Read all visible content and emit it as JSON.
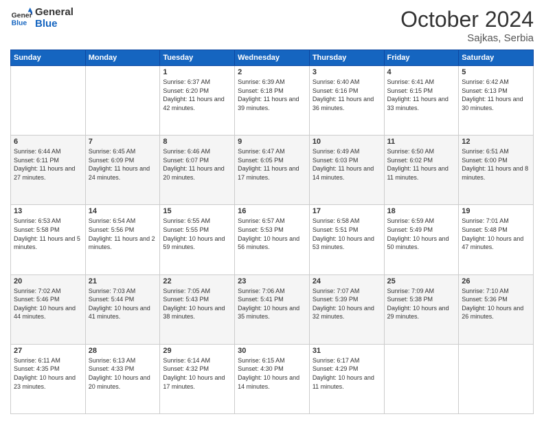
{
  "header": {
    "logo_line1": "General",
    "logo_line2": "Blue",
    "month": "October 2024",
    "location": "Sajkas, Serbia"
  },
  "days_of_week": [
    "Sunday",
    "Monday",
    "Tuesday",
    "Wednesday",
    "Thursday",
    "Friday",
    "Saturday"
  ],
  "weeks": [
    [
      {
        "day": "",
        "content": ""
      },
      {
        "day": "",
        "content": ""
      },
      {
        "day": "1",
        "content": "Sunrise: 6:37 AM\nSunset: 6:20 PM\nDaylight: 11 hours and 42 minutes."
      },
      {
        "day": "2",
        "content": "Sunrise: 6:39 AM\nSunset: 6:18 PM\nDaylight: 11 hours and 39 minutes."
      },
      {
        "day": "3",
        "content": "Sunrise: 6:40 AM\nSunset: 6:16 PM\nDaylight: 11 hours and 36 minutes."
      },
      {
        "day": "4",
        "content": "Sunrise: 6:41 AM\nSunset: 6:15 PM\nDaylight: 11 hours and 33 minutes."
      },
      {
        "day": "5",
        "content": "Sunrise: 6:42 AM\nSunset: 6:13 PM\nDaylight: 11 hours and 30 minutes."
      }
    ],
    [
      {
        "day": "6",
        "content": "Sunrise: 6:44 AM\nSunset: 6:11 PM\nDaylight: 11 hours and 27 minutes."
      },
      {
        "day": "7",
        "content": "Sunrise: 6:45 AM\nSunset: 6:09 PM\nDaylight: 11 hours and 24 minutes."
      },
      {
        "day": "8",
        "content": "Sunrise: 6:46 AM\nSunset: 6:07 PM\nDaylight: 11 hours and 20 minutes."
      },
      {
        "day": "9",
        "content": "Sunrise: 6:47 AM\nSunset: 6:05 PM\nDaylight: 11 hours and 17 minutes."
      },
      {
        "day": "10",
        "content": "Sunrise: 6:49 AM\nSunset: 6:03 PM\nDaylight: 11 hours and 14 minutes."
      },
      {
        "day": "11",
        "content": "Sunrise: 6:50 AM\nSunset: 6:02 PM\nDaylight: 11 hours and 11 minutes."
      },
      {
        "day": "12",
        "content": "Sunrise: 6:51 AM\nSunset: 6:00 PM\nDaylight: 11 hours and 8 minutes."
      }
    ],
    [
      {
        "day": "13",
        "content": "Sunrise: 6:53 AM\nSunset: 5:58 PM\nDaylight: 11 hours and 5 minutes."
      },
      {
        "day": "14",
        "content": "Sunrise: 6:54 AM\nSunset: 5:56 PM\nDaylight: 11 hours and 2 minutes."
      },
      {
        "day": "15",
        "content": "Sunrise: 6:55 AM\nSunset: 5:55 PM\nDaylight: 10 hours and 59 minutes."
      },
      {
        "day": "16",
        "content": "Sunrise: 6:57 AM\nSunset: 5:53 PM\nDaylight: 10 hours and 56 minutes."
      },
      {
        "day": "17",
        "content": "Sunrise: 6:58 AM\nSunset: 5:51 PM\nDaylight: 10 hours and 53 minutes."
      },
      {
        "day": "18",
        "content": "Sunrise: 6:59 AM\nSunset: 5:49 PM\nDaylight: 10 hours and 50 minutes."
      },
      {
        "day": "19",
        "content": "Sunrise: 7:01 AM\nSunset: 5:48 PM\nDaylight: 10 hours and 47 minutes."
      }
    ],
    [
      {
        "day": "20",
        "content": "Sunrise: 7:02 AM\nSunset: 5:46 PM\nDaylight: 10 hours and 44 minutes."
      },
      {
        "day": "21",
        "content": "Sunrise: 7:03 AM\nSunset: 5:44 PM\nDaylight: 10 hours and 41 minutes."
      },
      {
        "day": "22",
        "content": "Sunrise: 7:05 AM\nSunset: 5:43 PM\nDaylight: 10 hours and 38 minutes."
      },
      {
        "day": "23",
        "content": "Sunrise: 7:06 AM\nSunset: 5:41 PM\nDaylight: 10 hours and 35 minutes."
      },
      {
        "day": "24",
        "content": "Sunrise: 7:07 AM\nSunset: 5:39 PM\nDaylight: 10 hours and 32 minutes."
      },
      {
        "day": "25",
        "content": "Sunrise: 7:09 AM\nSunset: 5:38 PM\nDaylight: 10 hours and 29 minutes."
      },
      {
        "day": "26",
        "content": "Sunrise: 7:10 AM\nSunset: 5:36 PM\nDaylight: 10 hours and 26 minutes."
      }
    ],
    [
      {
        "day": "27",
        "content": "Sunrise: 6:11 AM\nSunset: 4:35 PM\nDaylight: 10 hours and 23 minutes."
      },
      {
        "day": "28",
        "content": "Sunrise: 6:13 AM\nSunset: 4:33 PM\nDaylight: 10 hours and 20 minutes."
      },
      {
        "day": "29",
        "content": "Sunrise: 6:14 AM\nSunset: 4:32 PM\nDaylight: 10 hours and 17 minutes."
      },
      {
        "day": "30",
        "content": "Sunrise: 6:15 AM\nSunset: 4:30 PM\nDaylight: 10 hours and 14 minutes."
      },
      {
        "day": "31",
        "content": "Sunrise: 6:17 AM\nSunset: 4:29 PM\nDaylight: 10 hours and 11 minutes."
      },
      {
        "day": "",
        "content": ""
      },
      {
        "day": "",
        "content": ""
      }
    ]
  ]
}
